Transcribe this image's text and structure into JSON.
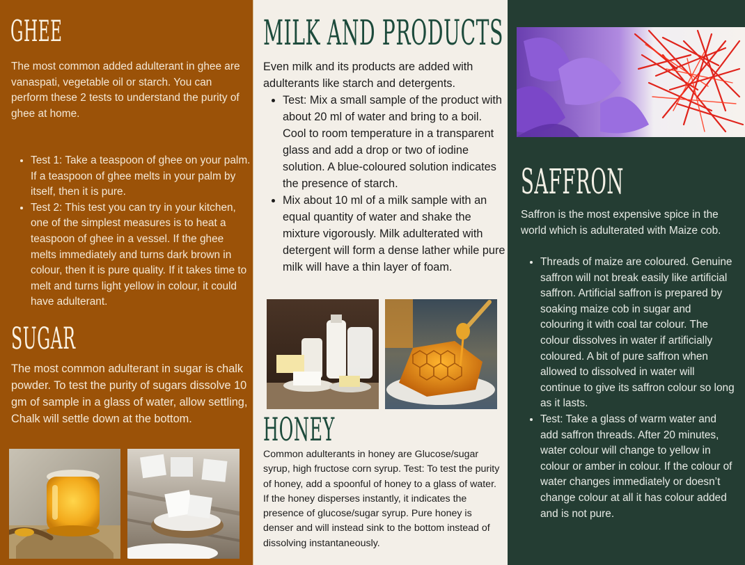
{
  "ghee": {
    "title": "GHEE",
    "intro": "The most common added adulterant in ghee are vanaspati, vegetable oil or starch. You can perform these 2 tests to understand the purity of ghee at home.",
    "tests": [
      "Test 1: Take a teaspoon of ghee on your palm. If a teaspoon of ghee melts in your palm by itself, then it is pure.",
      "Test 2: This test you can try in your kitchen, one of the simplest measures is to heat a teaspoon of ghee in a vessel. If the ghee melts immediately and turns dark brown in colour, then it is pure quality. If it takes time to melt and turns light yellow in colour, it could have adulterant."
    ]
  },
  "sugar": {
    "title": "SUGAR",
    "text": "The most common adulterant in sugar is chalk powder. To test the purity of sugars dissolve 10 gm of sample in a glass of water, allow settling, Chalk will settle down at the bottom."
  },
  "milk": {
    "title": "MILK AND PRODUCTS",
    "intro": "Even milk and its products are added with adulterants like starch and detergents.",
    "tests": [
      "Test: Mix a small sample of the product with about 20 ml of water and bring to a boil. Cool to room temperature in a transparent glass and add a drop or two of iodine solution. A blue-coloured solution indicates the presence of starch.",
      "Mix about 10 ml of a milk sample with an equal quantity of water and shake the mixture vigorously. Milk adulterated with detergent will form a dense lather while pure milk will have a thin layer of foam."
    ]
  },
  "honey": {
    "title": "HONEY",
    "text": "Common adulterants in honey are Glucose/sugar syrup, high fructose corn syrup. Test: To test the purity of honey, add a spoonful of honey to a glass of water. If the honey disperses instantly, it indicates the presence of glucose/sugar syrup. Pure honey is denser and will instead sink to the bottom instead of dissolving instantaneously."
  },
  "saffron": {
    "title": "SAFFRON",
    "intro": "Saffron is the most expensive spice in the world which is adulterated with Maize cob.",
    "tests": [
      "Threads of maize are coloured. Genuine saffron will not break easily like artificial saffron. Artificial saffron is prepared by soaking maize cob in sugar and colouring it with coal tar colour. The colour dissolves in water if artificially coloured. A bit of pure saffron when allowed to dissolved in water will continue to give its saffron colour so long as it lasts.",
      "Test: Take a glass of warm water and add saffron threads. After 20 minutes, water colour will change to yellow in colour or amber in colour. If the colour of water changes immediately or doesn’t change colour at all it has colour added and is not pure."
    ]
  },
  "colors": {
    "ghee_panel": "#9b5208",
    "milk_panel": "#f3efe8",
    "saffron_panel": "#243d33",
    "milk_heading": "#1c4a3b"
  },
  "images": [
    "ghee-jar-photo",
    "sugar-cubes-photo",
    "dairy-products-photo",
    "honeycomb-photo",
    "saffron-flowers-photo"
  ]
}
